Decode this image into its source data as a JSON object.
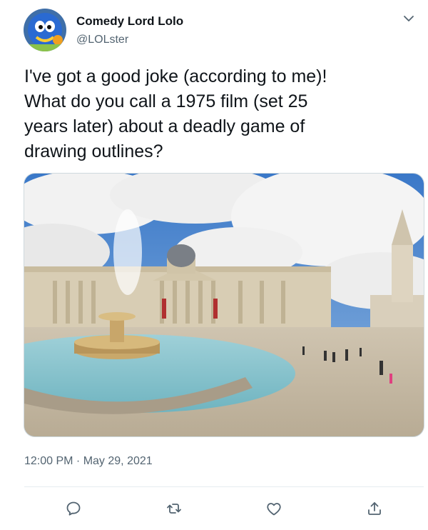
{
  "user": {
    "display_name": "Comedy Lord Lolo",
    "handle": "@LOLster"
  },
  "tweet": {
    "text": "I've got a good joke (according to me)!\nWhat do you call a 1975 film (set 25\nyears later) about a deadly game of\ndrawing outlines?",
    "timestamp": "12:00 PM · May 29, 2021"
  },
  "icons": {
    "more": "chevron-down-icon",
    "reply": "reply-icon",
    "retweet": "retweet-icon",
    "like": "heart-icon",
    "share": "share-icon"
  },
  "colors": {
    "secondary_text": "#536471",
    "icon": "#536471",
    "divider": "#e6ecf0"
  }
}
